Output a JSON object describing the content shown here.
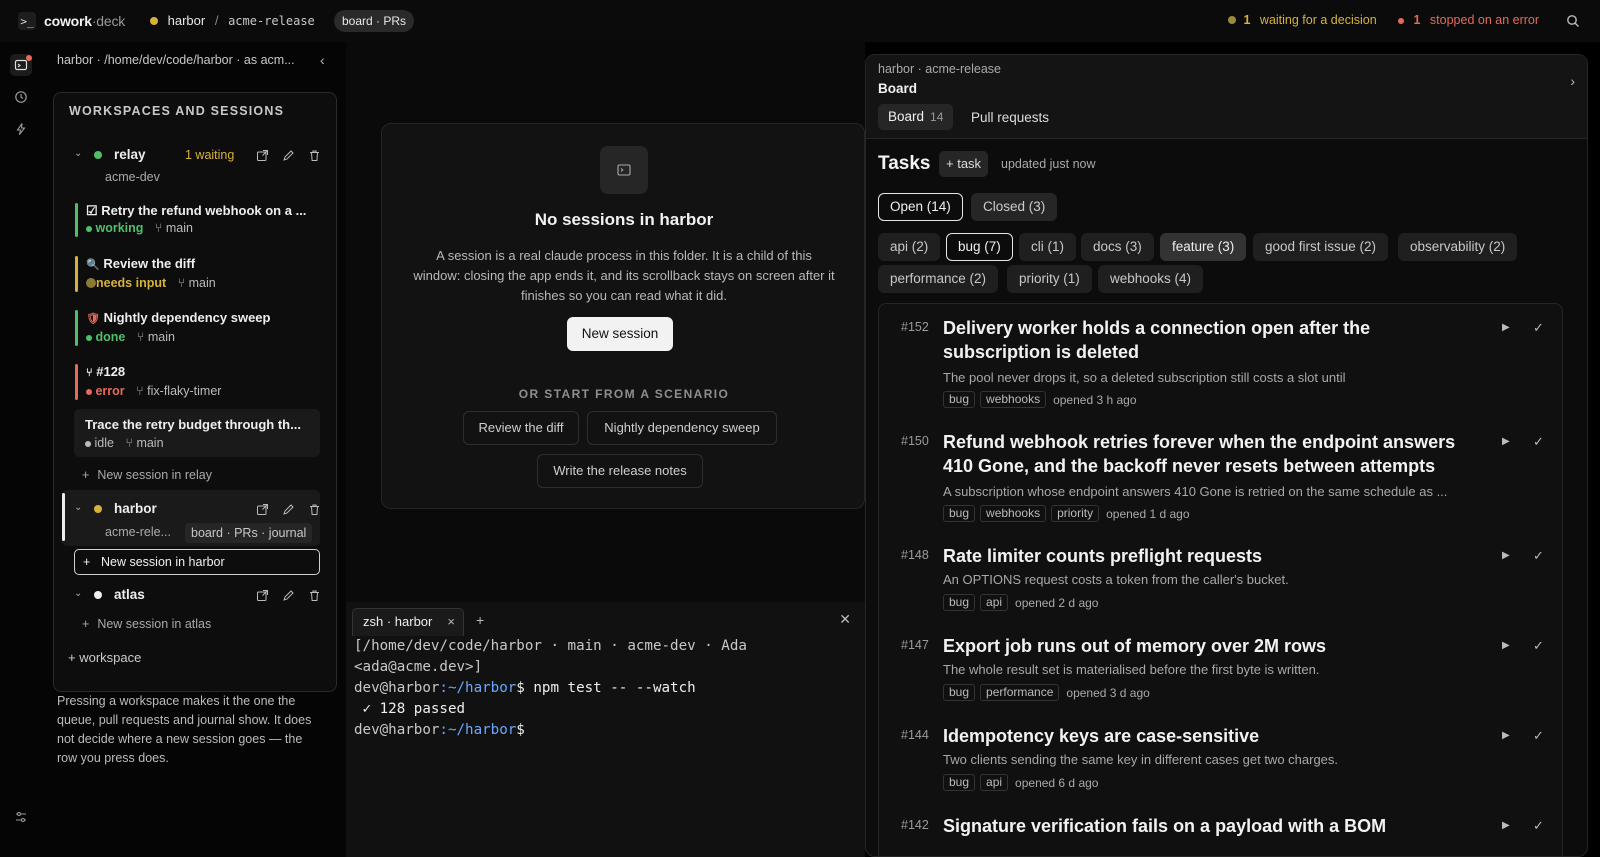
{
  "topbar": {
    "brand_a": "cowork",
    "brand_b": "·deck",
    "workspace": "harbor",
    "separator": "/",
    "branch": "acme-release",
    "view_pill": "board · PRs",
    "waiting_count": "1",
    "waiting_label": "waiting for a decision",
    "error_count": "1",
    "error_label": "stopped on an error",
    "colors": {
      "waiting": "#d7b23a",
      "error": "#e56a5a"
    }
  },
  "sidebar": {
    "path": "harbor · /home/dev/code/harbor · as acm...",
    "title": "WORKSPACES AND SESSIONS",
    "workspaces": [
      {
        "name": "relay",
        "badge": "1 waiting",
        "branch": "acme-dev",
        "sessions": [
          {
            "icon": "☑",
            "title": "Retry the refund webhook on a ...",
            "status": "working",
            "branch": "main"
          },
          {
            "icon": "🔍",
            "title": "Review the diff",
            "status": "needs input",
            "branch": "main"
          },
          {
            "icon": "🛡",
            "title": "Nightly dependency sweep",
            "status": "done",
            "branch": "main"
          },
          {
            "icon": "⑂",
            "title": "#128",
            "status": "error",
            "branch": "fix-flaky-timer"
          },
          {
            "icon": "",
            "title": "Trace the retry budget through th...",
            "status": "idle",
            "branch": "main"
          }
        ],
        "new_session": "New session in relay"
      },
      {
        "name": "harbor",
        "branch": "acme-rele...",
        "views": "board · PRs · journal",
        "new_session": "New session in harbor"
      },
      {
        "name": "atlas",
        "new_session": "New session in atlas"
      }
    ],
    "add_workspace": "+ workspace",
    "hint": "Pressing a workspace makes it the one the queue, pull requests and journal show. It does not decide where a new session goes — the row you press does."
  },
  "center": {
    "empty_title": "No sessions in harbor",
    "empty_desc": "A session is a real claude process in this folder. It is a child of this window: closing the app ends it, and its scrollback stays on screen after it finishes so you can read what it did.",
    "new_session": "New session",
    "or_scenario": "OR START FROM A SCENARIO",
    "scenarios": [
      "Review the diff",
      "Nightly dependency sweep",
      "Write the release notes"
    ]
  },
  "terminal": {
    "tab": "zsh · harbor",
    "line1": "[/home/dev/code/harbor · main · acme-dev · Ada <ada@acme.dev>]",
    "prompt_user": "dev@harbor",
    "prompt_path": ":~/harbor",
    "prompt_dollar": "$",
    "command": " npm test -- --watch",
    "result": " ✓ 128 passed"
  },
  "board": {
    "crumb": "harbor · acme-release",
    "title": "Board",
    "tab_board": "Board",
    "tab_board_count": "14",
    "tab_prs": "Pull requests",
    "tasks_heading": "Tasks",
    "add_task": "+ task",
    "updated": "updated just now",
    "open_label": "Open (14)",
    "closed_label": "Closed (3)",
    "labels": [
      "api (2)",
      "bug (7)",
      "cli (1)",
      "docs (3)",
      "feature (3)",
      "good first issue (2)",
      "observability (2)",
      "performance (2)",
      "priority (1)",
      "webhooks (4)"
    ],
    "tasks": [
      {
        "num": "#152",
        "title": "Delivery worker holds a connection open after the subscription is deleted",
        "desc": "The pool never drops it, so a deleted subscription still costs a slot until",
        "tags": [
          "bug",
          "webhooks"
        ],
        "opened": "opened 3 h ago"
      },
      {
        "num": "#150",
        "title": "Refund webhook retries forever when the endpoint answers 410 Gone, and the backoff never resets between attempts",
        "desc": "A subscription whose endpoint answers 410 Gone is retried on the same schedule as ...",
        "tags": [
          "bug",
          "webhooks",
          "priority"
        ],
        "opened": "opened 1 d ago"
      },
      {
        "num": "#148",
        "title": "Rate limiter counts preflight requests",
        "desc": "An OPTIONS request costs a token from the caller's bucket.",
        "tags": [
          "bug",
          "api"
        ],
        "opened": "opened 2 d ago"
      },
      {
        "num": "#147",
        "title": "Export job runs out of memory over 2M rows",
        "desc": "The whole result set is materialised before the first byte is written.",
        "tags": [
          "bug",
          "performance"
        ],
        "opened": "opened 3 d ago"
      },
      {
        "num": "#144",
        "title": "Idempotency keys are case-sensitive",
        "desc": "Two clients sending the same key in different cases get two charges.",
        "tags": [
          "bug",
          "api"
        ],
        "opened": "opened 6 d ago"
      },
      {
        "num": "#142",
        "title": "Signature verification fails on a payload with a BOM",
        "desc": "",
        "tags": [],
        "opened": ""
      }
    ]
  }
}
